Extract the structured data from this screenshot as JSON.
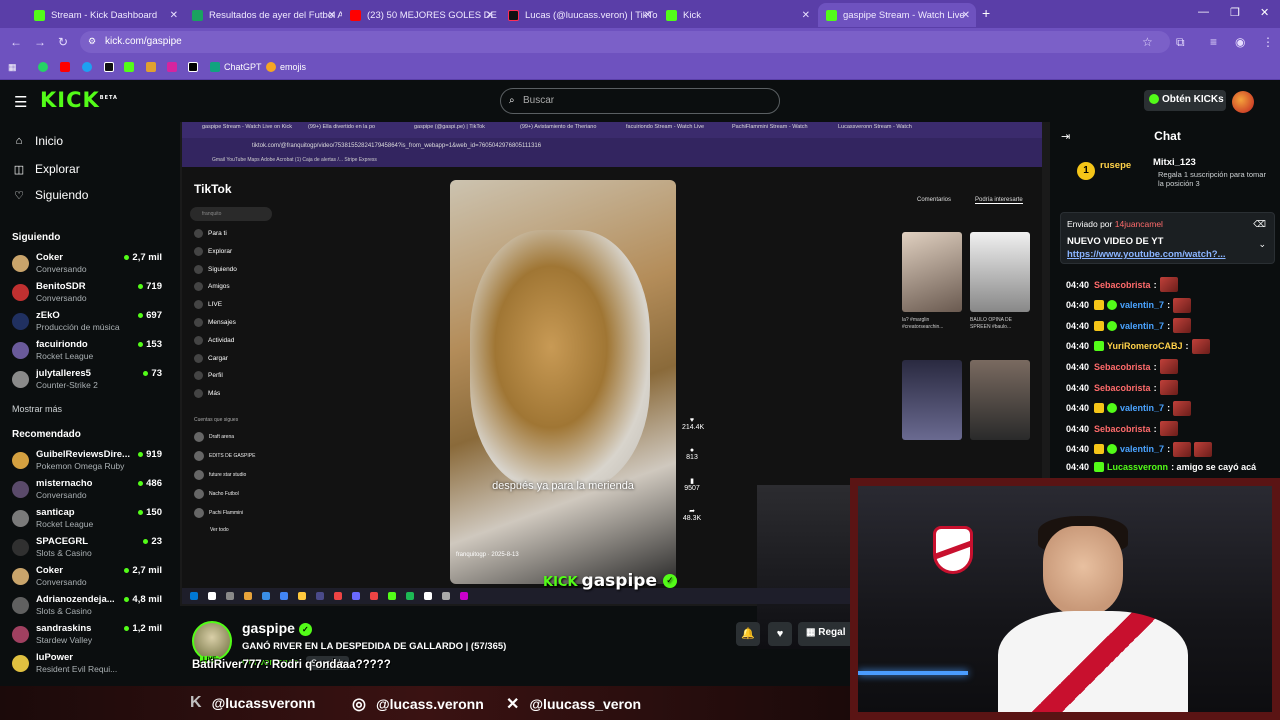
{
  "browser": {
    "tabs": [
      {
        "label": "Stream - Kick Dashboard",
        "color": "#53fc18"
      },
      {
        "label": "Resultados de ayer del Futbol A",
        "color": "#1aa260"
      },
      {
        "label": "(23) 50 MEJORES GOLES DE RI",
        "color": "#ff0000"
      },
      {
        "label": "Lucas (@luucass.veron) | TikTok",
        "color": "#111111"
      },
      {
        "label": "Kick",
        "color": "#53fc18"
      },
      {
        "label": "gaspipe Stream - Watch Live",
        "color": "#53fc18"
      }
    ],
    "url": "kick.com/gaspipe",
    "bookmarks": [
      {
        "label": "",
        "color": "#25d366"
      },
      {
        "label": "",
        "color": "#ff0000"
      },
      {
        "label": "",
        "color": "#1da1f2"
      },
      {
        "label": "",
        "color": "#111111"
      },
      {
        "label": "",
        "color": "#53fc18"
      },
      {
        "label": "",
        "color": "#e0a030"
      },
      {
        "label": "",
        "color": "#d6249f"
      },
      {
        "label": "",
        "color": "#000000"
      },
      {
        "label": "ChatGPT",
        "color": "#10a37f"
      },
      {
        "label": "emojis",
        "color": "#f5a623"
      }
    ]
  },
  "header": {
    "logo": "KICK",
    "logo_sup": "BETA",
    "search_placeholder": "Buscar",
    "get_kicks": "Obtén KICKs"
  },
  "sidebar": {
    "nav": [
      {
        "label": "Inicio",
        "icon": "home-icon"
      },
      {
        "label": "Explorar",
        "icon": "compass-icon"
      },
      {
        "label": "Siguiendo",
        "icon": "heart-icon"
      }
    ],
    "following_title": "Siguiendo",
    "following": [
      {
        "name": "Coker",
        "category": "Conversando",
        "viewers": "2,7 mil",
        "color": "#c9a46b"
      },
      {
        "name": "BenitoSDR",
        "category": "Conversando",
        "viewers": "719",
        "color": "#c03030"
      },
      {
        "name": "zEkO",
        "category": "Producción de música",
        "viewers": "697",
        "color": "#203060"
      },
      {
        "name": "facuiriondo",
        "category": "Rocket League",
        "viewers": "153",
        "color": "#6a5a9a"
      },
      {
        "name": "julytalleres5",
        "category": "Counter-Strike 2",
        "viewers": "73",
        "color": "#8a8a8a"
      }
    ],
    "show_more": "Mostrar más",
    "recommended_title": "Recomendado",
    "recommended": [
      {
        "name": "GuibelReviewsDire...",
        "category": "Pokemon Omega Ruby",
        "viewers": "919",
        "color": "#d4a040"
      },
      {
        "name": "misternacho",
        "category": "Conversando",
        "viewers": "486",
        "color": "#5a4a6a"
      },
      {
        "name": "santicap",
        "category": "Rocket League",
        "viewers": "150",
        "color": "#7a7a7a"
      },
      {
        "name": "SPACEGRL",
        "category": "Slots & Casino",
        "viewers": "23",
        "color": "#303030"
      },
      {
        "name": "Coker",
        "category": "Conversando",
        "viewers": "2,7 mil",
        "color": "#c9a46b"
      },
      {
        "name": "Adrianozendeja...",
        "category": "Slots & Casino",
        "viewers": "4,8 mil",
        "color": "#606060"
      },
      {
        "name": "sandraskins",
        "category": "Stardew Valley",
        "viewers": "1,2 mil",
        "color": "#a04060"
      },
      {
        "name": "luPower",
        "category": "Resident Evil Requi...",
        "viewers": "",
        "color": "#e0c040"
      }
    ]
  },
  "video": {
    "inner_tabs": [
      "gaspipe Stream - Watch Live on Kick",
      "(99+) Ella divertido en la po",
      "gaspipe (@gaspi.pe) | TikTok",
      "(99+) Avistamiento de Theriano",
      "facuiriondo Stream - Watch Live",
      "PachiFlammini Stream - Watch",
      "Lucassveronn Stream - Watch"
    ],
    "inner_url": "tiktok.com/@franquitogp/video/7538155282417945864?is_from_webapp=1&web_id=7605042976805111316",
    "inner_bookmarks": "Gmail   YouTube   Maps   Adobe Acrobat   (1) Caja de alertas /...   Stripe Express",
    "tiktok": {
      "logo": "TikTok",
      "search": "franquito",
      "nav": [
        "Para ti",
        "Explorar",
        "Siguiendo",
        "Amigos",
        "LIVE",
        "Mensajes",
        "Actividad",
        "Cargar",
        "Perfil",
        "Más"
      ],
      "accounts_title": "Cuentas que sigues",
      "accounts": [
        "Draft arena",
        "EDITS DE GASPIPE",
        "future star studio",
        "Nacho Futbol",
        "Pachi Flammini"
      ],
      "see_all": "Ver todo",
      "caption": "después ya para la merienda",
      "video_user": "franquitogp · 2025-8-13",
      "actions": [
        "214.4K",
        "813",
        "9507",
        "48.3K"
      ],
      "right_tabs": [
        "Comentarios",
        "Podría interesarte"
      ],
      "thumb_caps": [
        "la? #marglin #creatorsearchin...",
        "BAULO OPINA DE SPREEN #baulo..."
      ]
    },
    "overlay_brand": "gaspipe",
    "overlay_kick": "KICK"
  },
  "chat": {
    "title": "Chat",
    "sub_user1": "rusepe",
    "sub_user2": "Mitxi_123",
    "sub_text": "Regala 1 suscripción para tomar la posición 3",
    "pinned_by_label": "Enviado por",
    "pinned_by": "14juancamel",
    "pinned_title": "NUEVO VIDEO DE YT",
    "pinned_link": "https://www.youtube.com/watch?...",
    "messages": [
      {
        "time": "04:40",
        "user": "Sebacobrista",
        "color": "#ff6b6b",
        "text": ":",
        "emotes": 1,
        "badges": []
      },
      {
        "time": "04:40",
        "user": "valentin_7",
        "color": "#4aa3ff",
        "text": ":",
        "emotes": 1,
        "badges": [
          "#f5c518",
          "#53fc18"
        ]
      },
      {
        "time": "04:40",
        "user": "valentin_7",
        "color": "#4aa3ff",
        "text": ":",
        "emotes": 1,
        "badges": [
          "#f5c518",
          "#53fc18"
        ]
      },
      {
        "time": "04:40",
        "user": "YuriRomeroCABJ",
        "color": "#ffd24a",
        "text": ":",
        "emotes": 1,
        "badges": [
          "#53fc18"
        ]
      },
      {
        "time": "04:40",
        "user": "Sebacobrista",
        "color": "#ff6b6b",
        "text": ":",
        "emotes": 1,
        "badges": []
      },
      {
        "time": "04:40",
        "user": "Sebacobrista",
        "color": "#ff6b6b",
        "text": ":",
        "emotes": 1,
        "badges": []
      },
      {
        "time": "04:40",
        "user": "valentin_7",
        "color": "#4aa3ff",
        "text": ":",
        "emotes": 1,
        "badges": [
          "#f5c518",
          "#53fc18"
        ]
      },
      {
        "time": "04:40",
        "user": "Sebacobrista",
        "color": "#ff6b6b",
        "text": ":",
        "emotes": 1,
        "badges": []
      },
      {
        "time": "04:40",
        "user": "valentin_7",
        "color": "#4aa3ff",
        "text": ":",
        "emotes": 2,
        "badges": [
          "#f5c518",
          "#53fc18"
        ]
      },
      {
        "time": "04:40",
        "user": "Lucassveronn",
        "color": "#53fc18",
        "text": ": amigo se cayó acá",
        "emotes": 0,
        "badges": [
          "#53fc18"
        ]
      }
    ]
  },
  "stream": {
    "channel": "gaspipe",
    "title": "GANÓ RIVER EN LA DESPEDIDA DE GALLARDO | (57/365)",
    "category": "Conversando",
    "language": "Spanish",
    "live": "LIVE",
    "gift_label": "Regal",
    "overlay_message": "BatiRiver777 : Rodri q ondaaa?????"
  },
  "social": {
    "kick": "@lucassveronn",
    "instagram": "@lucass.veronn",
    "x": "@luucass_veron"
  }
}
